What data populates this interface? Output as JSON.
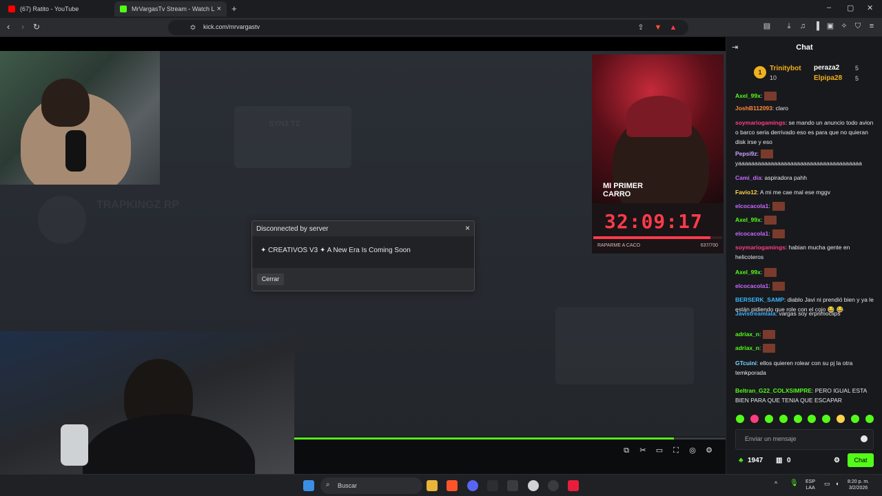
{
  "browser": {
    "tabs": [
      {
        "title": "(67) Ratito - YouTube",
        "favicon_color": "#ff0000",
        "active": false
      },
      {
        "title": "MrVargasTv Stream - Watch L",
        "favicon_color": "#53fc18",
        "active": true
      }
    ],
    "url": "kick.com/mrvargastv",
    "new_tab_label": "+"
  },
  "stream": {
    "ghost_texts": [
      "TRAPKINGZ RP",
      "SYN3 TZ"
    ],
    "cam_overlay_text": "MI PRIMER CARRO",
    "timer": {
      "value": "32:09:17",
      "label": "RAPARME A CACO",
      "count": "637/700",
      "progress": 0.91
    },
    "progress": 0.88
  },
  "dialog": {
    "title": "Disconnected by server",
    "message": "✦ CREATIVOS V3 ✦ A New Era Is Coming Soon",
    "button": "Cerrar",
    "close_glyph": "×"
  },
  "chat": {
    "title": "Chat",
    "leaderboard": [
      {
        "name": "Trinitybot",
        "value": "10",
        "color": "#f2b01e"
      },
      {
        "name": "peraza2",
        "value": "5",
        "color": "#ffffff"
      },
      {
        "name": "Elpipa28",
        "value": "5",
        "color": "#f2b01e"
      }
    ],
    "messages": [
      {
        "user": "Axel_99x",
        "color": "#53fc18",
        "text": ":"
      },
      {
        "user": "JoshB112093",
        "color": "#ff8a3d",
        "text": ": claro"
      },
      {
        "user": "soymariogamings",
        "color": "#ff3d7f",
        "text": ": se mando un anuncio todo avion o barco seria derrivado eso es para que no quieran disk irse y eso"
      },
      {
        "user": "Pepsi9z",
        "color": "#c8a2ff",
        "text": ":"
      },
      {
        "user": "",
        "color": "#e8e9ec",
        "text": "yaaaaaaaaaaaaaaaaaaaaaaaaaaaaaaaaaaaaaa"
      },
      {
        "user": "Cami_dia",
        "color": "#c86bff",
        "text": ": aspiradora pahh"
      },
      {
        "user": "Favio12",
        "color": "#ffd24a",
        "text": ": A mi me cae mal ese mggv"
      },
      {
        "user": "elcocacola1",
        "color": "#c86bff",
        "text": ":"
      },
      {
        "user": "Axel_99x",
        "color": "#53fc18",
        "text": ":"
      },
      {
        "user": "elcocacola1",
        "color": "#c86bff",
        "text": ":"
      },
      {
        "user": "soymariogamings",
        "color": "#ff3d7f",
        "text": ": habian mucha gente en helicoteros"
      },
      {
        "user": "Axel_99x",
        "color": "#53fc18",
        "text": ":"
      },
      {
        "user": "elcocacola1",
        "color": "#c86bff",
        "text": ":"
      },
      {
        "user": "BERSERK_SAMP",
        "color": "#3db5ff",
        "text": ": diablo Javi ni prendió bien y ya le están pidiendo que role con el cojo 😂 😂"
      },
      {
        "user": "Javistreamlala",
        "color": "#3db5ff",
        "text": ": vargas soy erprimoclips"
      },
      {
        "user": "adriax_n",
        "color": "#53fc18",
        "text": ":"
      },
      {
        "user": "adriax_n",
        "color": "#53fc18",
        "text": ":"
      },
      {
        "user": "GTcuini",
        "color": "#7ad7ff",
        "text": ": ellos quieren rolear con su pj la otra temkporada"
      },
      {
        "user": "Beltran_G22_COLXSIMPRE",
        "color": "#53fc18",
        "text": ": PERO IGUAL ESTA BIEN PARA QUE TENIA QUE ESCAPAR"
      }
    ],
    "input_placeholder": "Enviar un mensaje",
    "footer": {
      "points": "1947",
      "gifts": "0",
      "send_label": "Chat"
    }
  },
  "taskbar": {
    "search_placeholder": "Buscar",
    "lang": "ESP",
    "lang2": "LAA",
    "time": "8:20 p. m.",
    "date": "3/2/2026"
  }
}
